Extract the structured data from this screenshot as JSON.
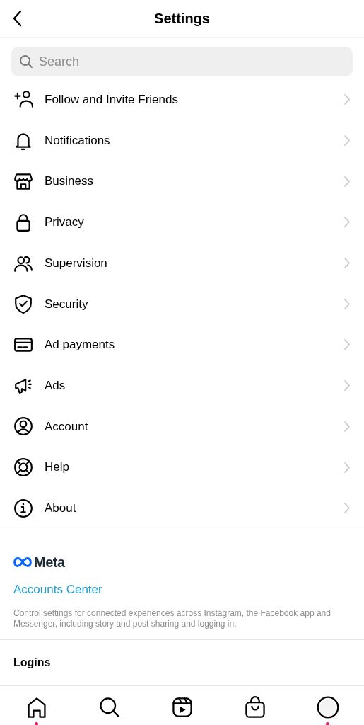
{
  "header": {
    "title": "Settings"
  },
  "search": {
    "placeholder": "Search"
  },
  "items": [
    {
      "kind": "follow",
      "label": "Follow and Invite Friends"
    },
    {
      "kind": "bell",
      "label": "Notifications"
    },
    {
      "kind": "store",
      "label": "Business"
    },
    {
      "kind": "lock",
      "label": "Privacy"
    },
    {
      "kind": "people",
      "label": "Supervision"
    },
    {
      "kind": "shield",
      "label": "Security"
    },
    {
      "kind": "card",
      "label": "Ad payments"
    },
    {
      "kind": "megaphone",
      "label": "Ads"
    },
    {
      "kind": "account",
      "label": "Account"
    },
    {
      "kind": "lifebuoy",
      "label": "Help"
    },
    {
      "kind": "info",
      "label": "About"
    }
  ],
  "meta": {
    "brand": "Meta",
    "link": "Accounts Center",
    "description": "Control settings for connected experiences across Instagram, the Facebook app and Messenger, including story and post sharing and logging in."
  },
  "logins": {
    "title": "Logins"
  },
  "nav": [
    {
      "kind": "home",
      "badge": true
    },
    {
      "kind": "search",
      "badge": false
    },
    {
      "kind": "reels",
      "badge": false
    },
    {
      "kind": "shop",
      "badge": false
    },
    {
      "kind": "profile",
      "badge": true
    }
  ]
}
